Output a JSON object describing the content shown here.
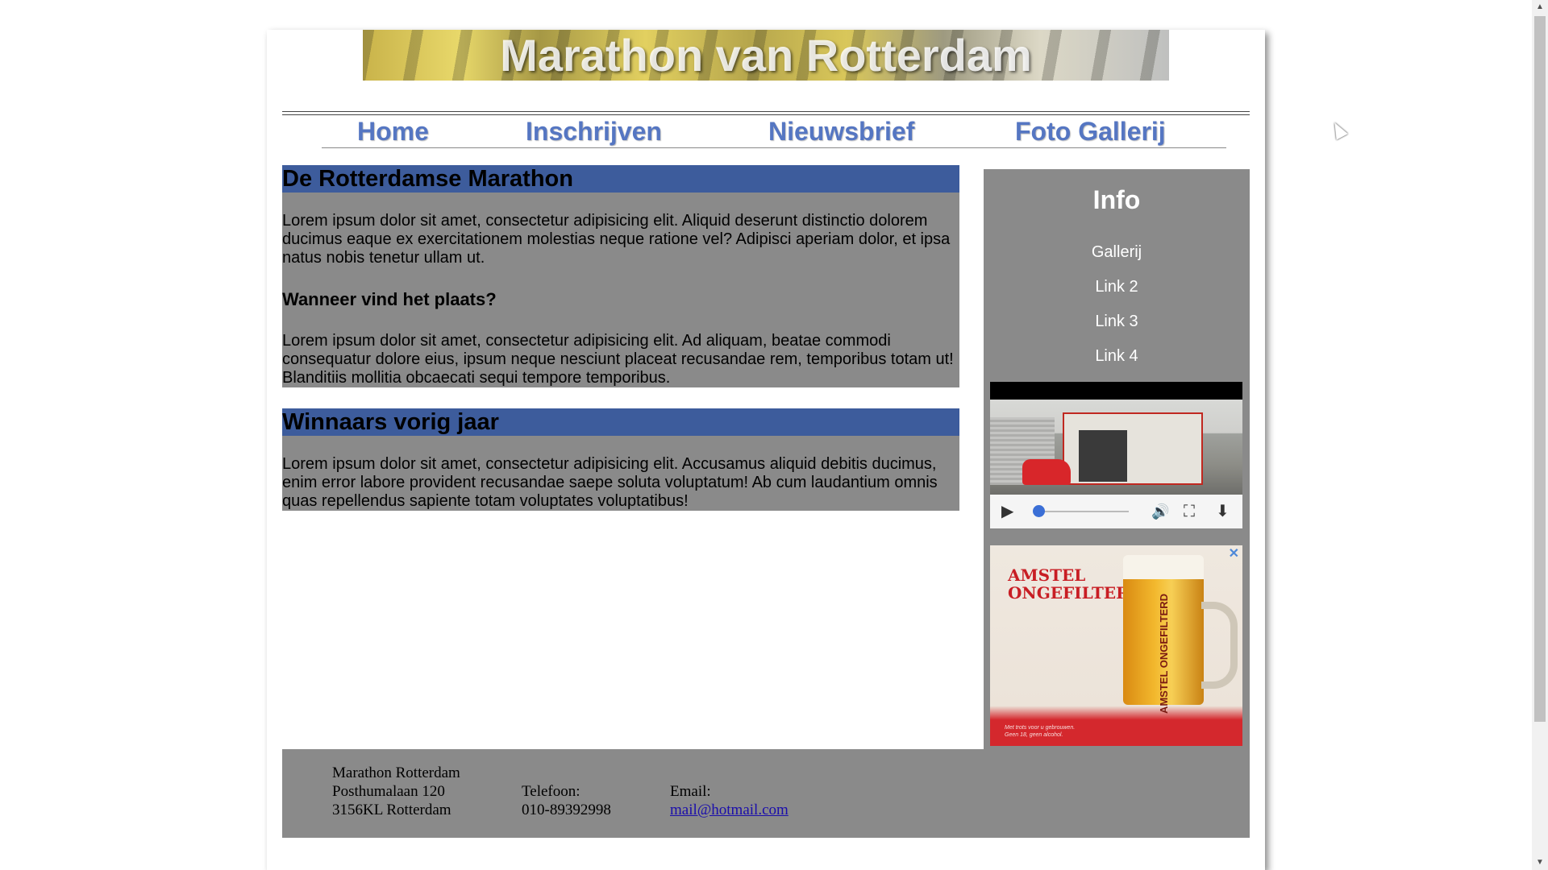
{
  "banner": {
    "title": "Marathon van Rotterdam"
  },
  "nav": {
    "items": [
      {
        "label": "Home"
      },
      {
        "label": "Inschrijven"
      },
      {
        "label": "Nieuwsbrief"
      },
      {
        "label": "Foto Gallerij"
      }
    ]
  },
  "main": {
    "sections": [
      {
        "heading": "De Rotterdamse Marathon",
        "paragraph1": "Lorem ipsum dolor sit amet, consectetur adipisicing elit. Aliquid deserunt distinctio dolorem ducimus eaque ex exercitationem molestias neque ratione vel? Adipisci aperiam dolor, et ipsa natus nobis tenetur ullam ut.",
        "subheading": "Wanneer vind het plaats?",
        "paragraph2": "Lorem ipsum dolor sit amet, consectetur adipisicing elit. Ad aliquam, beatae commodi consequatur dolore eius, ipsum neque nesciunt placeat recusandae rem, temporibus totam ut! Blanditiis mollitia obcaecati sequi tempore temporibus."
      },
      {
        "heading": "Winnaars vorig jaar",
        "paragraph1": "Lorem ipsum dolor sit amet, consectetur adipisicing elit. Accusamus aliquid debitis ducimus, enim error labore provident recusandae saepe soluta voluptatum! Ab cum laudantium omnis quas repellendus sapiente totam voluptates voluptatibus!"
      }
    ]
  },
  "sidebar": {
    "title": "Info",
    "links": [
      {
        "label": "Gallerij"
      },
      {
        "label": "Link 2"
      },
      {
        "label": "Link 3"
      },
      {
        "label": "Link 4"
      }
    ],
    "video": {
      "progress": 0.0
    },
    "ad": {
      "headline_line1": "AMSTEL",
      "headline_line2": "ONGEFILTERD",
      "close_glyph": "✕",
      "mug_label": "AMSTEL ONGEFILTERD",
      "small_print_line1": "Met trots voor u gebrouwen.",
      "small_print_line2": "Geen 18, geen alcohol."
    }
  },
  "footer": {
    "org_name": "Marathon Rotterdam",
    "address_line1": "Posthumalaan 120",
    "address_line2": "3156KL Rotterdam",
    "phone_label": "Telefoon:",
    "phone_value": "010-89392998",
    "email_label": "Email:",
    "email_value": "mail@hotmail.com"
  },
  "colors": {
    "nav_link": "#5576c2",
    "section_heading_bg": "#3d5c9c",
    "panel_bg": "#8a8a8a",
    "link_color": "#1a0dab"
  },
  "icons": {
    "play": "▶",
    "volume": "🔊",
    "fullscreen": "⛶",
    "download": "⬇",
    "scroll_up": "▲",
    "scroll_down": "▼"
  }
}
